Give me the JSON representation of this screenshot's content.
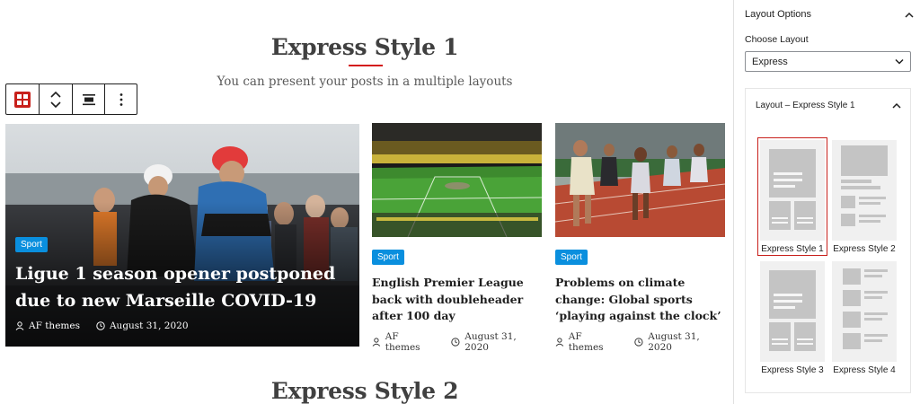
{
  "canvas": {
    "section1_title": "Express Style 1",
    "section1_subtitle": "You can present your posts in a multiple layouts",
    "section2_title": "Express Style 2",
    "accent_color": "#d31c1c",
    "badge_color": "#0a8fde",
    "posts": [
      {
        "category": "Sport",
        "title": "Ligue 1 season opener postponed due to new Marseille COVID-19",
        "author": "AF themes",
        "date": "August 31, 2020",
        "image": "cyclists-racing-photo"
      },
      {
        "category": "Sport",
        "title": "English Premier League back with doubleheader after 100 day",
        "author": "AF themes",
        "date": "August 31, 2020",
        "image": "football-stadium-photo"
      },
      {
        "category": "Sport",
        "title": "Problems on climate change: Global sports ‘playing against the clock’",
        "author": "AF themes",
        "date": "August 31, 2020",
        "image": "women-running-track-photo"
      }
    ]
  },
  "toolbar": {
    "block_icon": "grid-block-icon",
    "move_icon": "move-up-down-icon",
    "align_icon": "align-center-icon",
    "more_icon": "more-vertical-icon"
  },
  "sidebar": {
    "panel_title": "Layout Options",
    "choose_label": "Choose Layout",
    "selected_layout": "Express",
    "sub_panel_title": "Layout – Express Style 1",
    "styles": [
      {
        "label": "Express Style 1",
        "selected": true
      },
      {
        "label": "Express Style 2",
        "selected": false
      },
      {
        "label": "Express Style 3",
        "selected": false
      },
      {
        "label": "Express Style 4",
        "selected": false
      }
    ],
    "selection_color": "#c8201b"
  }
}
